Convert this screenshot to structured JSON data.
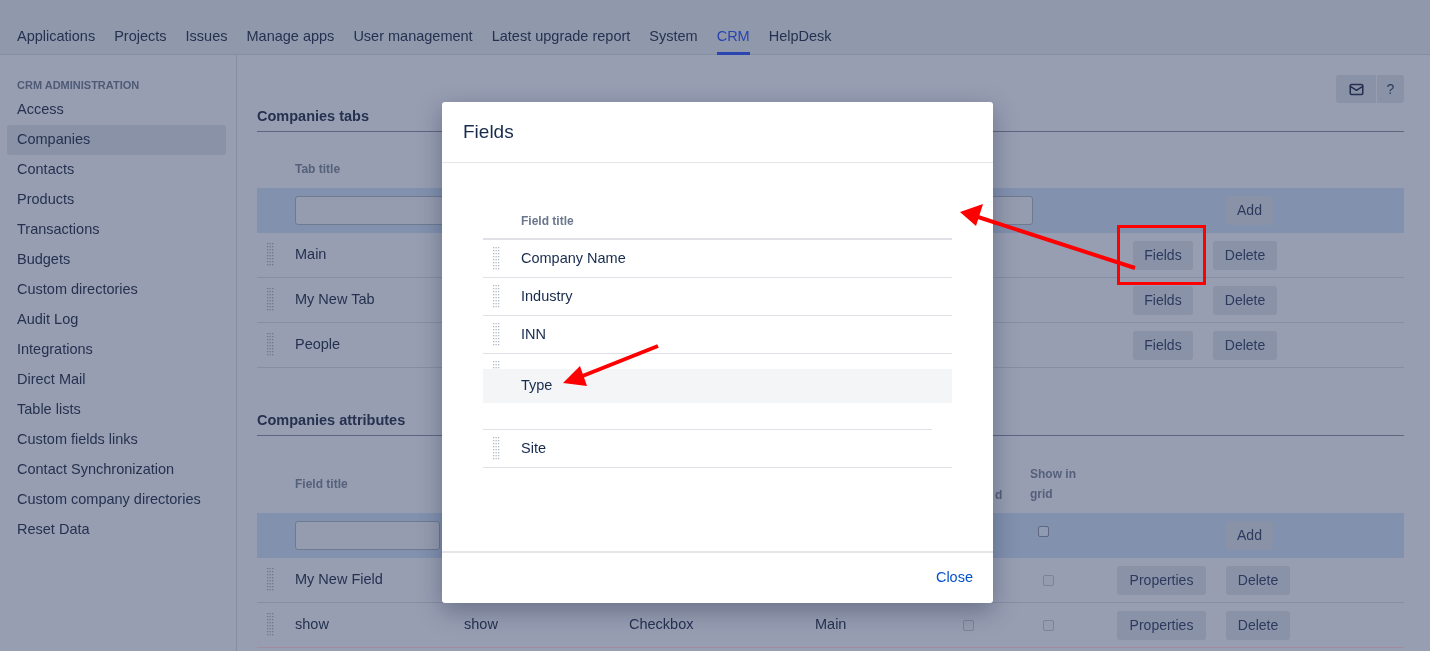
{
  "nav": {
    "tabs": [
      {
        "label": "Applications",
        "selected": false
      },
      {
        "label": "Projects",
        "selected": false
      },
      {
        "label": "Issues",
        "selected": false
      },
      {
        "label": "Manage apps",
        "selected": false
      },
      {
        "label": "User management",
        "selected": false
      },
      {
        "label": "Latest upgrade report",
        "selected": false
      },
      {
        "label": "System",
        "selected": false
      },
      {
        "label": "CRM",
        "selected": true
      },
      {
        "label": "HelpDesk",
        "selected": false
      }
    ]
  },
  "sidebar": {
    "heading": "CRM ADMINISTRATION",
    "items": [
      {
        "label": "Access",
        "selected": false
      },
      {
        "label": "Companies",
        "selected": true
      },
      {
        "label": "Contacts",
        "selected": false
      },
      {
        "label": "Products",
        "selected": false
      },
      {
        "label": "Transactions",
        "selected": false
      },
      {
        "label": "Budgets",
        "selected": false
      },
      {
        "label": "Custom directories",
        "selected": false
      },
      {
        "label": "Audit Log",
        "selected": false
      },
      {
        "label": "Integrations",
        "selected": false
      },
      {
        "label": "Direct Mail",
        "selected": false
      },
      {
        "label": "Table lists",
        "selected": false
      },
      {
        "label": "Custom fields links",
        "selected": false
      },
      {
        "label": "Contact Synchronization",
        "selected": false
      },
      {
        "label": "Custom company directories",
        "selected": false
      },
      {
        "label": "Reset Data",
        "selected": false
      }
    ]
  },
  "toolbar": {
    "help_button": "?"
  },
  "tabs_section": {
    "title": "Companies tabs",
    "column_header": "Tab title",
    "add_button": "Add",
    "rows": [
      {
        "title": "Main",
        "fields_button": "Fields",
        "delete_button": "Delete",
        "highlighted": true
      },
      {
        "title": "My New Tab",
        "fields_button": "Fields",
        "delete_button": "Delete",
        "highlighted": false
      },
      {
        "title": "People",
        "fields_button": "Fields",
        "delete_button": "Delete",
        "highlighted": false
      }
    ]
  },
  "attributes_section": {
    "title": "Companies attributes",
    "columns": {
      "field_title": "Field title",
      "column_5": "d",
      "show_in_grid": "Show in grid"
    },
    "add_row": {
      "show_in_grid": false,
      "add_button": "Add"
    },
    "rows": [
      {
        "field_title": "My New Field",
        "show_in_grid": false,
        "properties_button": "Properties",
        "delete_button": "Delete"
      },
      {
        "field_title": "show",
        "column_2": "show",
        "column_3": "Checkbox",
        "column_4": "Main",
        "column_5": false,
        "show_in_grid": false,
        "properties_button": "Properties",
        "delete_button": "Delete"
      }
    ]
  },
  "dialog": {
    "title": "Fields",
    "column_header": "Field title",
    "rows": [
      {
        "title": "Company Name",
        "dragging": false
      },
      {
        "title": "Industry",
        "dragging": false
      },
      {
        "title": "INN",
        "dragging": false
      },
      {
        "title": "Type",
        "dragging": true
      },
      {
        "title": "Site",
        "dragging": false
      }
    ],
    "close_link": "Close"
  }
}
